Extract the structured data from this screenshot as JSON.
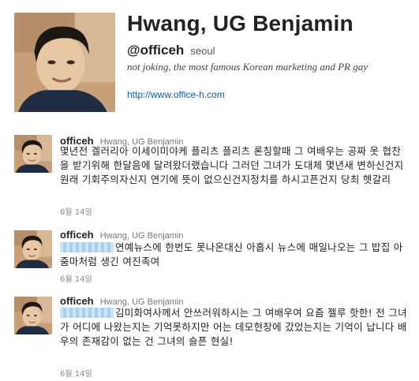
{
  "profile": {
    "name": "Hwang, UG Benjamin",
    "handle": "@officeh",
    "location": "seoul",
    "bio": "not joking, the most famous Korean marketing and PR gay",
    "url": "http://www.office-h.com"
  },
  "tweets": [
    {
      "user": "officeh",
      "full_name": "Hwang, UG Benjamin",
      "text": "몇년전 겔러리아 이세이미야케 플리츠 플리츠 론칭할때 그 여배우는 공짜 옷 협찬을 받기위해 한달음에 달려왔더랬습니다 그러던 그녀가 도대체 몇년새 변하신건지 원래 기회주의자신지 연기에 뜻이 없으신건지정치를 하시고픈건지 당최 헷갈리",
      "date": "6월 14일"
    },
    {
      "user": "officeh",
      "full_name": "Hwang, UG Benjamin",
      "text": "연예뉴스에 한번도 못나온대신 아홉시 뉴스에 매일나오는 그 밥집 아줌마처럼 생긴 여진족여",
      "date": "6월 14일"
    },
    {
      "user": "officeh",
      "full_name": "Hwang, UG Benjamin",
      "text": "김미화여사께서 안쓰러워하시는 그 여배우여 요즘 젤루 핫한! 전 그녀가 어디에 나왔는지는 기억못하지만 어는 데모현장에 갔었는지는 기억이 납니다 배우의 존재감이 없는 건 그녀의 슬픈 현실!",
      "date": "6월 14일"
    }
  ]
}
